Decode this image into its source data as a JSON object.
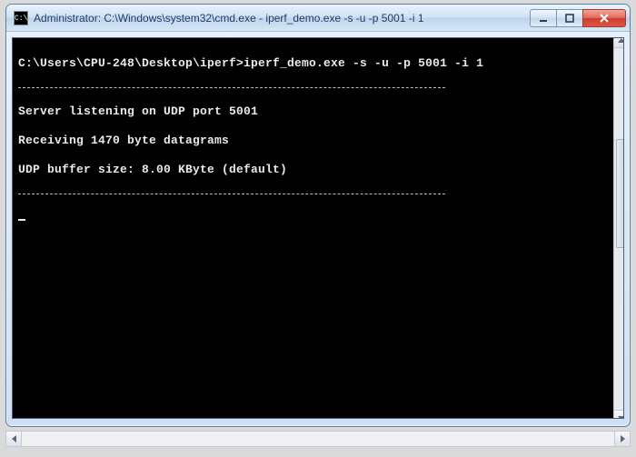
{
  "window": {
    "icon_glyph": "C:\\",
    "title": "Administrator: C:\\Windows\\system32\\cmd.exe - iperf_demo.exe  -s -u -p 5001  -i 1"
  },
  "terminal": {
    "prompt_line": "C:\\Users\\CPU-248\\Desktop\\iperf>iperf_demo.exe -s -u -p 5001 -i 1",
    "lines": [
      "Server listening on UDP port 5001",
      "Receiving 1470 byte datagrams",
      "UDP buffer size: 8.00 KByte (default)"
    ]
  }
}
